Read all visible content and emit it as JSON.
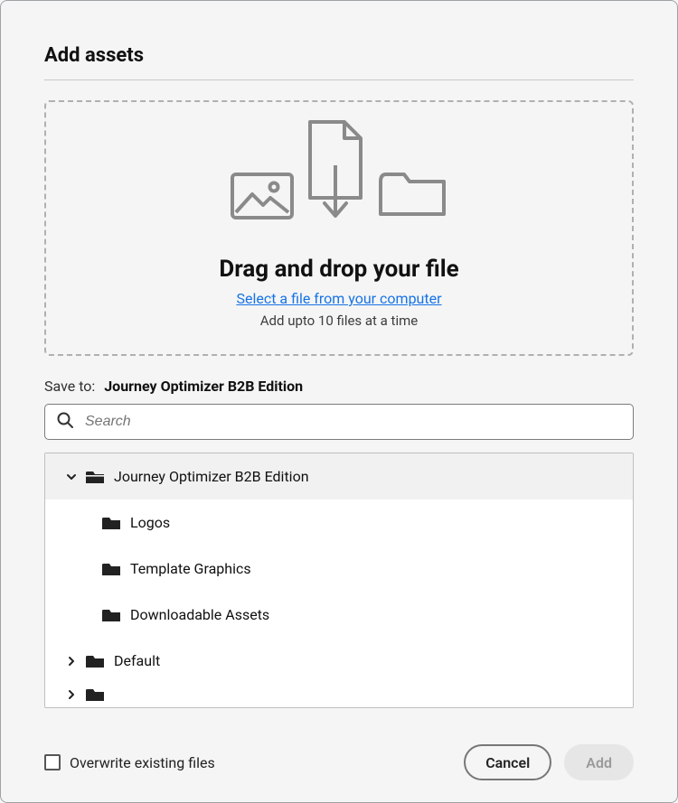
{
  "dialog": {
    "title": "Add assets"
  },
  "dropzone": {
    "title": "Drag and drop your file",
    "select_link": "Select a file from your computer",
    "hint": "Add upto 10 files at a time"
  },
  "save_to": {
    "label": "Save to:",
    "value": "Journey Optimizer B2B Edition"
  },
  "search": {
    "placeholder": "Search"
  },
  "tree": {
    "root": {
      "label": "Journey Optimizer B2B Edition",
      "expanded": true,
      "children": [
        {
          "label": "Logos"
        },
        {
          "label": "Template Graphics"
        },
        {
          "label": "Downloadable Assets"
        }
      ]
    },
    "siblings": [
      {
        "label": "Default",
        "expanded": false
      }
    ]
  },
  "overwrite": {
    "label": "Overwrite existing files",
    "checked": false
  },
  "buttons": {
    "cancel": "Cancel",
    "add": "Add"
  }
}
